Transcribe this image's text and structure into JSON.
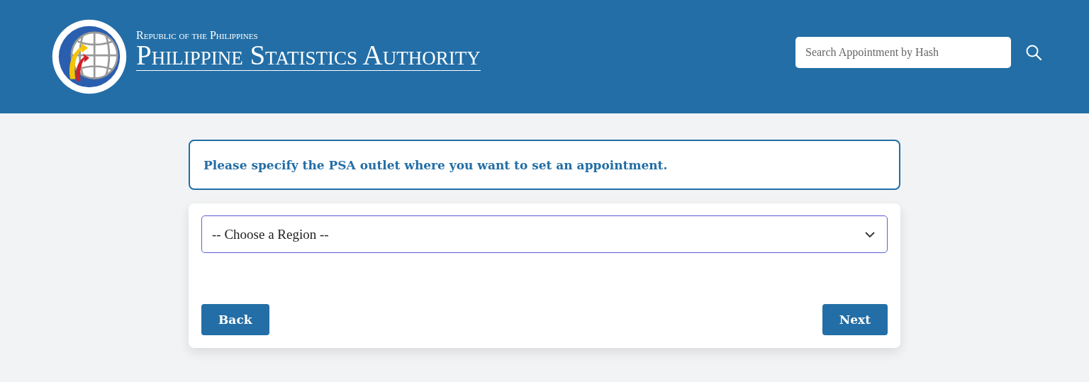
{
  "header": {
    "kicker": "Republic of the Philippines",
    "title": "Philippine Statistics Authority",
    "search": {
      "placeholder": "Search Appointment by Hash"
    }
  },
  "prompt": "Please specify the PSA outlet where you want to set an appointment.",
  "region_select": {
    "value": "-- Choose a Region --"
  },
  "buttons": [
    "Back",
    "Next"
  ]
}
